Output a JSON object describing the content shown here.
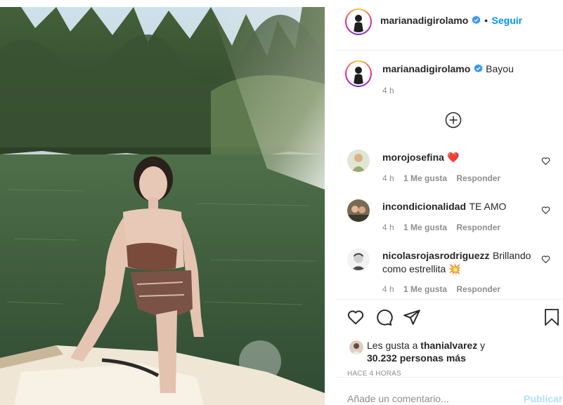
{
  "post": {
    "author": "marianadigirolamo",
    "follow_label": "Seguir",
    "caption_author": "marianadigirolamo",
    "caption_text": "Bayou",
    "caption_time": "4 h"
  },
  "comments": [
    {
      "user": "morojosefina",
      "text": "❤️",
      "time": "4 h",
      "likes": "1 Me gusta",
      "reply": "Responder"
    },
    {
      "user": "incondicionalidad",
      "text": "TE AMO",
      "time": "4 h",
      "likes": "1 Me gusta",
      "reply": "Responder"
    },
    {
      "user": "nicolasrojasrodriguezz",
      "text_line1": "Brillando",
      "text_line2": "como estrellita 💥",
      "time": "4 h",
      "likes": "1 Me gusta",
      "reply": "Responder"
    }
  ],
  "likes_summary": {
    "prefix": "Les gusta a",
    "user": "thanialvarez",
    "conj": "y",
    "count": "30.232 personas más"
  },
  "posted_ago": "HACE 4 HORAS",
  "comment_box": {
    "placeholder": "Añade un comentario...",
    "publish_label": "Publicar"
  },
  "colors": {
    "link": "#0095f6",
    "verified": "#3897f0",
    "heart": "#ed4956",
    "publish_disabled": "#b2dffc"
  },
  "icons": [
    "verified-icon",
    "load-more-icon",
    "heart-icon",
    "comment-icon",
    "share-icon",
    "bookmark-icon"
  ]
}
